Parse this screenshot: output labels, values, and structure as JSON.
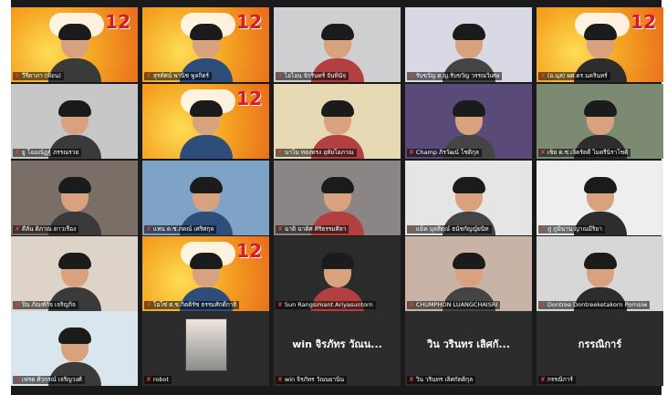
{
  "meeting": {
    "tiles": [
      {
        "name": "วีรีดาภา (ฟ้อน)",
        "kind": "banner"
      },
      {
        "name": "สุรทัศน์ พานิช พูลกิตร์",
        "kind": "banner"
      },
      {
        "name": "ไอไอน จักรินทร์ จันทินัจ",
        "kind": "video"
      },
      {
        "name": "รับขวัญ ด.ญ.รับขวัญ วรรณวิเศษ",
        "kind": "video"
      },
      {
        "name": "(อ.นุส) ผศ.ดร.นครินทร์",
        "kind": "banner"
      },
      {
        "name": "ยู โฉมณัฏฐ์ ภรรณรวย",
        "kind": "video"
      },
      {
        "name": "",
        "kind": "banner"
      },
      {
        "name": "นาโม ทองทรง อุทัยโอภาณ",
        "kind": "video"
      },
      {
        "name": "Champ ภิรวัฒน์ โชติกุล",
        "kind": "video"
      },
      {
        "name": "เซ็ย ด.ช.เจิดรัตติ์ ไมตรีนิราโชติ",
        "kind": "video"
      },
      {
        "name": "ดีลัน ดิภาณ ดาวเรือง",
        "kind": "video"
      },
      {
        "name": "แทน ด.ช.ภคณ์ เศริศกุล",
        "kind": "video"
      },
      {
        "name": "ฉาดิ ฉาดิศ ศิริธรรมศิลา",
        "kind": "video"
      },
      {
        "name": "แม็ค บุลสิตุณ์ ธนัชกัญญ์ยนิท",
        "kind": "video"
      },
      {
        "name": "ภู ภูมินาน ญาณมีริยา",
        "kind": "video"
      },
      {
        "name": "ปิน ภัณฑ์กิจ เจริญกิจ",
        "kind": "video"
      },
      {
        "name": "โอโซ่ ด.ช.กิตติรัช ธรรมศักดิ์กาธิ",
        "kind": "banner"
      },
      {
        "name": "Sun Rangsimant Ariyasuntorn",
        "kind": "video"
      },
      {
        "name": "CHUMPHON LUANGCHAISRI",
        "kind": "video"
      },
      {
        "name": "Dontree Dontreeketakorn Pornsiw",
        "kind": "video"
      },
      {
        "name": "เฟรด ศิวกรณ์ เจริญวงศ์",
        "kind": "video"
      },
      {
        "name": "robot",
        "kind": "photo"
      },
      {
        "name": "win จิรภัทร วัณนยานิน",
        "kind": "text",
        "big": "win จิรภัทร วัณน..."
      },
      {
        "name": "วิน วรินทร เลิศกัตติกุล",
        "kind": "text",
        "big": "วิน วรินทร เลิศกั..."
      },
      {
        "name": "กรรณิการ์",
        "kind": "text",
        "big": "กรรณิการ์"
      }
    ],
    "banner_number": "12",
    "colors": {
      "background": "#1a1a1a",
      "banner": "#f5b73b",
      "mic_muted": "#e53935"
    }
  }
}
